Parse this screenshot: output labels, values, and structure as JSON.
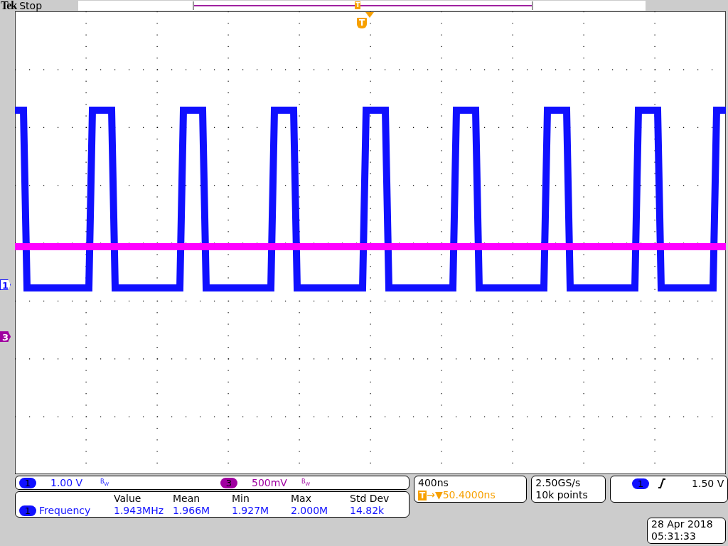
{
  "header": {
    "brand": "Tek",
    "status": "Stop",
    "record_marker": "T"
  },
  "screen": {
    "trigger_marker": "T"
  },
  "channel_markers": [
    {
      "label": "1",
      "color": "#1010ff",
      "kind": "outline"
    },
    {
      "label": "3",
      "color": "#a000a0",
      "kind": "filled"
    }
  ],
  "channels": [
    {
      "badge": "1",
      "scale": "1.00 V",
      "bandwidth": "B$_{W}$",
      "color": "#1010ff"
    },
    {
      "badge": "3",
      "scale": "500mV",
      "bandwidth": "B$_{W}$",
      "color": "#a000a0"
    }
  ],
  "measurements": {
    "columns": [
      "Value",
      "Mean",
      "Min",
      "Max",
      "Std Dev"
    ],
    "rows": [
      {
        "badge": "1",
        "name": "Frequency",
        "values": [
          "1.943MHz",
          "1.966M",
          "1.927M",
          "2.000M",
          "14.82k"
        ]
      }
    ]
  },
  "timebase": {
    "scale": "400ns",
    "trigger_badge": "T",
    "arrow": "→▼",
    "delay": "50.4000ns"
  },
  "acquisition": {
    "rate": "2.50GS/s",
    "length": "10k points"
  },
  "trigger": {
    "badge": "1",
    "level": "1.50 V"
  },
  "datetime": {
    "date": "28 Apr 2018",
    "time": "05:31:33"
  }
}
